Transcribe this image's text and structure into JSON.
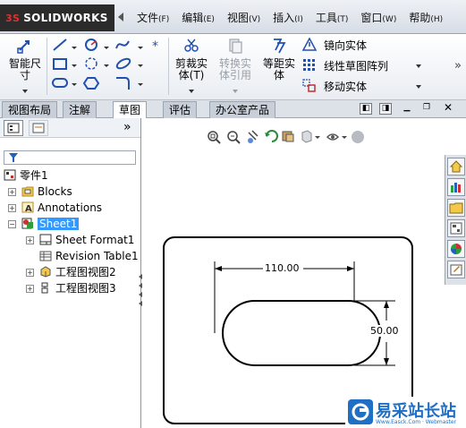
{
  "app": {
    "logo_text": "SOLIDWORKS",
    "logo_prefix": "3S"
  },
  "menu": [
    {
      "label": "文件",
      "key": "(F)"
    },
    {
      "label": "编辑",
      "key": "(E)"
    },
    {
      "label": "视图",
      "key": "(V)"
    },
    {
      "label": "插入",
      "key": "(I)"
    },
    {
      "label": "工具",
      "key": "(T)"
    },
    {
      "label": "窗口",
      "key": "(W)"
    },
    {
      "label": "帮助",
      "key": "(H)"
    }
  ],
  "ribbon": {
    "smart_dim_line1": "智能尺",
    "smart_dim_line2": "寸",
    "trim_line1": "剪裁实",
    "trim_line2": "体(T)",
    "convert_line1": "转换实",
    "convert_line2": "体引用",
    "offset_line1": "等距实",
    "offset_line2": "体",
    "mirror": "镜向实体",
    "linear_pattern": "线性草图阵列",
    "move": "移动实体"
  },
  "tabs": [
    "视图布局",
    "注解",
    "草图",
    "评估",
    "办公室产品"
  ],
  "active_tab": "草图",
  "tree": {
    "root": "零件1",
    "blocks": "Blocks",
    "annotations": "Annotations",
    "sheet": "Sheet1",
    "sheet_format": "Sheet Format1",
    "revision_table": "Revision Table1",
    "view2": "工程图视图2",
    "view3": "工程图视图3"
  },
  "drawing": {
    "dim_horizontal": "110.00",
    "dim_vertical": "50.00"
  },
  "watermark": {
    "title": "易采站长站",
    "subtitle": "Www.Easck.Com · Webmaster"
  },
  "colors": {
    "accent": "#3399ff",
    "logo_bg": "#2b2b2b",
    "watermark_blue": "#1f6fc5"
  }
}
